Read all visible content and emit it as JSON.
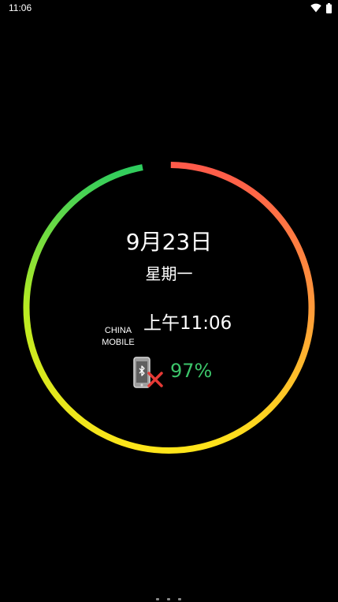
{
  "status_bar": {
    "time": "11:06",
    "icons": [
      "wifi-icon",
      "battery-icon"
    ]
  },
  "clock": {
    "date": "9月23日",
    "weekday": "星期一",
    "time": "上午11:06"
  },
  "carrier": {
    "line1": "CHINA",
    "line2": "MOBILE"
  },
  "device_status": {
    "icon": "bluetooth-phone-disconnected-icon",
    "battery_percent": "97%",
    "battery_level": 0.97
  },
  "colors": {
    "ring_start": "#ff5a4a",
    "ring_mid_orange": "#ff9a3a",
    "ring_bottom": "#ffe51a",
    "ring_yellow_green": "#d6f21a",
    "ring_end": "#2ecc5e",
    "battery_text": "#3cc56a",
    "disconnect_x": "#e53935"
  }
}
